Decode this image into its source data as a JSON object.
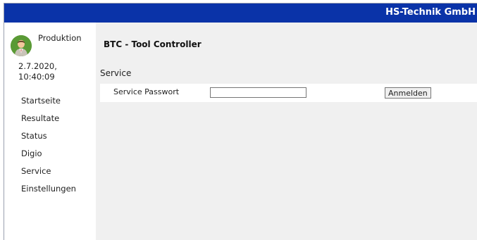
{
  "header": {
    "brand": "HS-Technik GmbH"
  },
  "user": {
    "name": "Produktion",
    "date": "2.7.2020,",
    "time": "10:40:09"
  },
  "nav": {
    "items": [
      {
        "label": "Startseite"
      },
      {
        "label": "Resultate"
      },
      {
        "label": "Status"
      },
      {
        "label": "Digio"
      },
      {
        "label": "Service"
      },
      {
        "label": "Einstellungen"
      }
    ]
  },
  "main": {
    "title": "BTC - Tool Controller",
    "section": "Service",
    "password_label": "Service Passwort",
    "password_value": "",
    "login_label": "Anmelden"
  },
  "colors": {
    "header": "#0a33a8",
    "content_bg": "#f0f0f0",
    "avatar": "#4f8f2f"
  },
  "icons": {
    "avatar": "user-avatar-icon"
  }
}
